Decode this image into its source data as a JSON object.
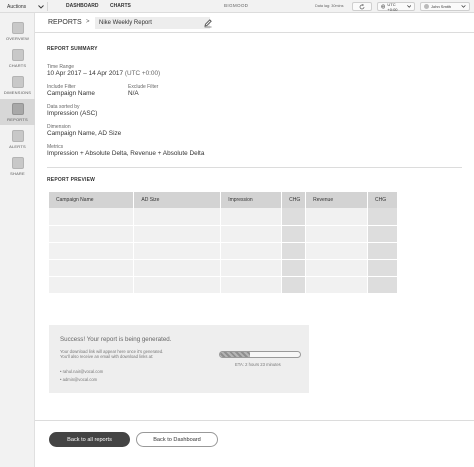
{
  "topbar": {
    "selector": "Auctions",
    "nav": [
      "DASHBOARD",
      "CHARTS"
    ],
    "brand": "BIGMOOD",
    "data_lag": "Data lag: 30mins",
    "timezone": "UTC +0:00",
    "user": "John Smith"
  },
  "sidebar": {
    "items": [
      {
        "label": "OVERVIEW",
        "icon": "overview-icon"
      },
      {
        "label": "CHARTS",
        "icon": "charts-icon"
      },
      {
        "label": "DIMENSIONS",
        "icon": "dimensions-icon"
      },
      {
        "label": "REPORTS",
        "icon": "reports-icon",
        "active": true
      },
      {
        "label": "ALERTS",
        "icon": "alerts-icon"
      },
      {
        "label": "SHARE",
        "icon": "share-icon"
      }
    ]
  },
  "header": {
    "title": "REPORTS",
    "separator": ">",
    "report_name": "Nike Weekly Report"
  },
  "summary": {
    "title": "REPORT SUMMARY",
    "time_range_label": "Time Range",
    "time_range_value": "10 Apr 2017 – 14 Apr 2017",
    "time_range_tz": "(UTC +0:00)",
    "include_label": "Include Filter",
    "include_value": "Campaign Name",
    "exclude_label": "Exclude Filter",
    "exclude_value": "N/A",
    "sorted_label": "Data sorted by",
    "sorted_value": "Impression (ASC)",
    "dimension_label": "Dimension",
    "dimension_value": "Campaign Name, AD Size",
    "metrics_label": "Metrics",
    "metrics_value": "Impression + Absolute Delta, Revenue + Absolute Delta"
  },
  "preview": {
    "title": "REPORT PREVIEW",
    "columns": [
      "Campaign Name",
      "AD Size",
      "Impression",
      "CHG",
      "Revenue",
      "CHG"
    ],
    "row_count": 5
  },
  "status": {
    "message": "Success! Your report is being generated.",
    "info_line1": "Your download link will appear here once it's generated.",
    "info_line2": "You'll also receive an email with download links at:",
    "emails": [
      "rahul.nair@vocal.com",
      "admin@vocal.com"
    ],
    "progress": 0.38,
    "eta": "ETA: 2 hours 23 minutes"
  },
  "buttons": {
    "back_reports": "Back to all reports",
    "back_dashboard": "Back to Dashboard"
  }
}
